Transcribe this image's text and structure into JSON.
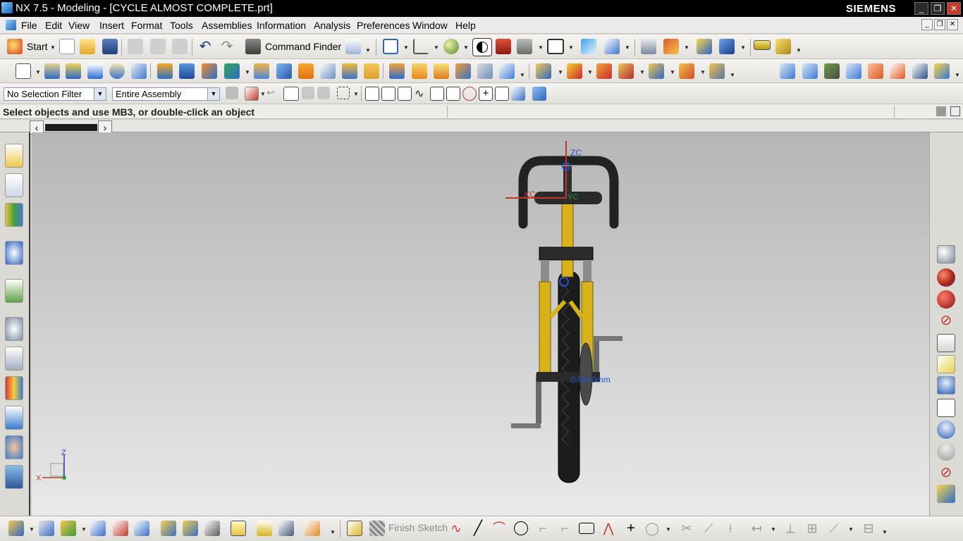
{
  "window": {
    "title": "NX 7.5 - Modeling - [CYCLE ALMOST COMPLETE.prt]",
    "brand": "SIEMENS",
    "minimize": "_",
    "restore": "❐",
    "close": "✕"
  },
  "menubar": {
    "items": [
      "File",
      "Edit",
      "View",
      "Insert",
      "Format",
      "Tools",
      "Assemblies",
      "Information",
      "Analysis",
      "Preferences",
      "Window",
      "Help"
    ]
  },
  "toolbar_standard": {
    "start_label": "Start",
    "command_finder_label": "Command Finder"
  },
  "selection_bar": {
    "type_filter": "No Selection Filter",
    "scope": "Entire Assembly"
  },
  "cue_line": {
    "message": "Select objects and use MB3, or double-click an object"
  },
  "viewport": {
    "triad_labels": {
      "z": "Z",
      "x": "X"
    },
    "wcs_labels": {
      "zc": "ZC",
      "xc": "XC",
      "yc": "YC"
    },
    "dimension_label": "0.0000mm"
  },
  "sketch_toolbar": {
    "finish_sketch_label": "Finish Sketch"
  },
  "colors": {
    "title_bar": "#000000",
    "frame_yellow": "#d9b21a",
    "tire_black": "#1c1c1c",
    "accent_blue": "#1f5fbf"
  }
}
